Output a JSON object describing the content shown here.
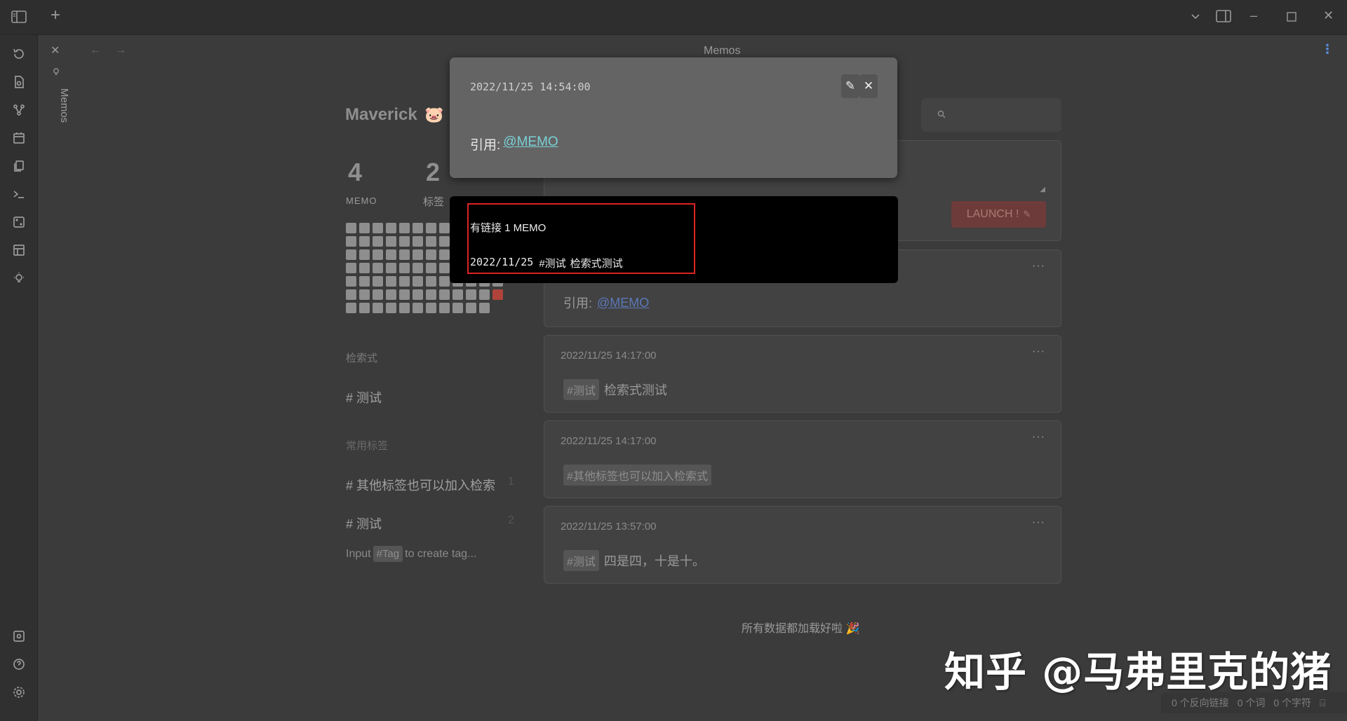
{
  "titlebar": {
    "view_title": "Memos"
  },
  "dock": {
    "vertical_label": "Memos"
  },
  "profile": {
    "name": "Maverick",
    "emoji": "🐷",
    "stats": [
      {
        "value": "4",
        "label": "MEMO"
      },
      {
        "value": "2",
        "label": "标签"
      }
    ]
  },
  "heatmap": {
    "rows": 7,
    "columns": 12,
    "highlighted_cells": 1
  },
  "sidebar": {
    "query_section_title": "检索式",
    "queries": [
      {
        "label": "# 测试"
      }
    ],
    "tags_section_title": "常用标签",
    "tags": [
      {
        "label": "# 其他标签也可以加入检索",
        "count": "1"
      },
      {
        "label": "# 测试",
        "count": "2"
      }
    ],
    "tag_hint_prefix": "Input",
    "tag_hint_chip": "#Tag",
    "tag_hint_suffix": "to create tag..."
  },
  "editor": {
    "launch_button": "LAUNCH !",
    "search_placeholder": ""
  },
  "memos": [
    {
      "time": "",
      "ref_label": "引用:",
      "ref_link": "@MEMO",
      "chip": "",
      "text": ""
    },
    {
      "time": "2022/11/25 14:17:00",
      "chip": "#测试",
      "text": "检索式测试"
    },
    {
      "time": "2022/11/25 14:17:00",
      "chip": "#其他标签也可以加入检索式",
      "text": ""
    },
    {
      "time": "2022/11/25 13:57:00",
      "chip": "#测试",
      "text": "四是四，十是十。"
    }
  ],
  "load_complete_text": "所有数据都加载好啦 🎉",
  "popup": {
    "timestamp": "2022/11/25 14:54:00",
    "ref_label": "引用:",
    "ref_link": "@MEMO"
  },
  "hover_preview": {
    "title": "有链接 1 MEMO",
    "date": "2022/11/25",
    "tag": "#测试",
    "text": "检索式测试"
  },
  "watermark": "知乎 @马弗里克的猪",
  "statusbar": {
    "backlinks": "0 个反向链接",
    "words": "0 个词",
    "chars": "0 个字符"
  },
  "colors": {
    "background": "#3b3b3b",
    "accent_link": "#7bd0d6",
    "launch_button": "#6e3b3b",
    "highlight_frame": "#dd2222"
  }
}
